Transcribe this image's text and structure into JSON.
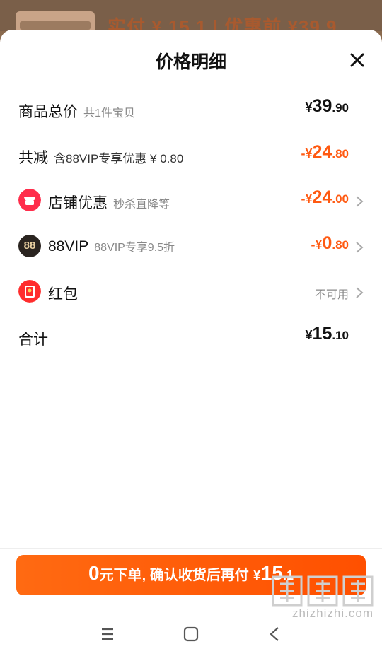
{
  "peek": {
    "text": "实付 ¥ 15.1 | 优惠前 ¥39.9"
  },
  "sheet": {
    "title": "价格明细"
  },
  "rows": {
    "total": {
      "label": "商品总价",
      "sub": "共1件宝贝",
      "currency": "¥",
      "int": "39",
      "dec": ".90"
    },
    "reduction": {
      "label": "共减",
      "sub": "含88VIP专享优惠 ¥ 0.80",
      "prefix": "-¥",
      "int": "24",
      "dec": ".80"
    },
    "store": {
      "label": "店铺优惠",
      "sub": "秒杀直降等",
      "prefix": "-¥",
      "int": "24",
      "dec": ".00"
    },
    "vip": {
      "label": "88VIP",
      "sub": "88VIP专享9.5折",
      "prefix": "-¥",
      "int": "0",
      "dec": ".80",
      "icon_text": "88"
    },
    "hongbao": {
      "label": "红包",
      "status": "不可用"
    },
    "sum": {
      "label": "合计",
      "currency": "¥",
      "int": "15",
      "dec": ".10"
    }
  },
  "cta": {
    "zero": "0",
    "text": "元下单, 确认收货后再付",
    "currency": "¥",
    "int": "15",
    "dec": ".1"
  },
  "watermark": {
    "text": "zhizhizhi.com"
  },
  "colors": {
    "accent": "#ff5a12",
    "store_icon": "#ff2d4b",
    "vip_icon": "#2a2420",
    "hongbao_icon": "#ff2d2d"
  },
  "icons": [
    "close-icon",
    "store-icon",
    "vip-88-icon",
    "red-packet-icon",
    "chevron-right-icon",
    "menu-icon",
    "home-icon",
    "back-icon"
  ]
}
